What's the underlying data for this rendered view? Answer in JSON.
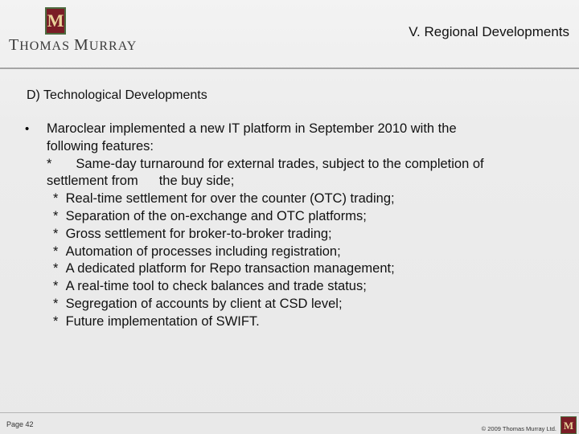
{
  "header": {
    "logo_monogram": "M",
    "brand_first_initial": "T",
    "brand_first_rest": "HOMAS",
    "brand_second_initial": "M",
    "brand_second_rest": "URRAY",
    "section_title": "V. Regional Developments",
    "colors": {
      "logo_fill": "#7a1d26",
      "logo_border": "#4d6b3f",
      "logo_text": "#e9d49a"
    }
  },
  "content": {
    "subheading": "D) Technological Developments",
    "bullet": "•",
    "intro_line_1": "Maroclear implemented a new IT platform in September 2010 with the",
    "intro_line_2": "following features:",
    "first_feature_marker": "*",
    "first_feature_line_1": "Same-day turnaround for external trades, subject to the completion of",
    "first_feature_line_2a": "settlement from",
    "first_feature_line_2b": "the buy side;",
    "features": [
      {
        "marker": "*",
        "text": "Real-time settlement for over the counter (OTC) trading;"
      },
      {
        "marker": "*",
        "text": "Separation of the on-exchange and OTC platforms;"
      },
      {
        "marker": "*",
        "text": "Gross settlement for broker-to-broker trading;"
      },
      {
        "marker": "*",
        "text": "Automation of processes including registration;"
      },
      {
        "marker": "*",
        "text": "A dedicated platform for Repo transaction management;"
      },
      {
        "marker": "*",
        "text": "A real-time tool to check balances and trade status;"
      },
      {
        "marker": "*",
        "text": "Segregation of accounts by client at CSD level;"
      },
      {
        "marker": "*",
        "text": "Future implementation of SWIFT."
      }
    ]
  },
  "footer": {
    "page_number": "Page 42",
    "copyright": "© 2009 Thomas Murray Ltd.",
    "logo_monogram": "M"
  }
}
